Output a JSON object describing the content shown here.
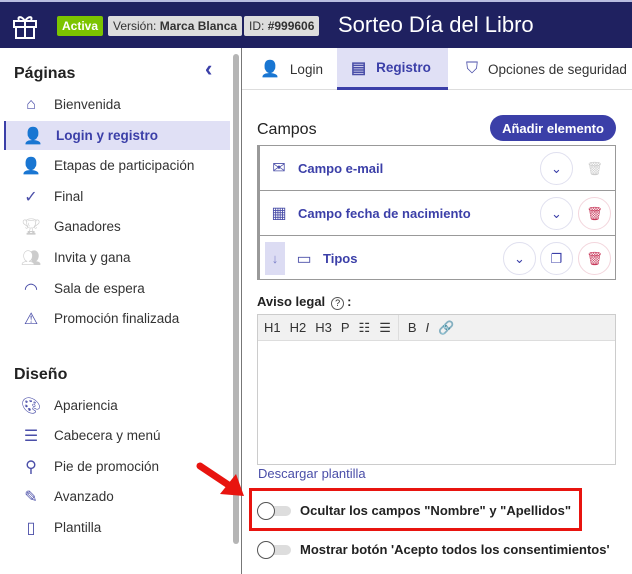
{
  "header": {
    "status": "Activa",
    "version_label": "Versión:",
    "version_value": "Marca Blanca",
    "id_label": "ID:",
    "id_value": "#999606",
    "title": "Sorteo Día del Libro"
  },
  "sidebar": {
    "pages_title": "Páginas",
    "pages": [
      {
        "label": "Bienvenida",
        "icon": "home-icon"
      },
      {
        "label": "Login y registro",
        "icon": "user-login-icon",
        "active": true
      },
      {
        "label": "Etapas de participación",
        "icon": "user-add-icon"
      },
      {
        "label": "Final",
        "icon": "check-icon"
      },
      {
        "label": "Ganadores",
        "icon": "trophy-icon"
      },
      {
        "label": "Invita y gana",
        "icon": "users-icon"
      },
      {
        "label": "Sala de espera",
        "icon": "gauge-icon"
      },
      {
        "label": "Promoción finalizada",
        "icon": "warning-icon"
      }
    ],
    "design_title": "Diseño",
    "design": [
      {
        "label": "Apariencia",
        "icon": "palette-icon"
      },
      {
        "label": "Cabecera y menú",
        "icon": "menu-icon"
      },
      {
        "label": "Pie de promoción",
        "icon": "footer-icon"
      },
      {
        "label": "Avanzado",
        "icon": "edit-icon"
      },
      {
        "label": "Plantilla",
        "icon": "file-icon"
      }
    ]
  },
  "tabs": [
    {
      "label": "Login"
    },
    {
      "label": "Registro",
      "active": true
    },
    {
      "label": "Opciones de seguridad"
    }
  ],
  "campos": {
    "title": "Campos",
    "add_label": "Añadir elemento",
    "fields": [
      {
        "label": "Campo e-mail"
      },
      {
        "label": "Campo fecha de nacimiento"
      },
      {
        "label": "Tipos"
      }
    ]
  },
  "legal": {
    "label": "Aviso legal",
    "suffix": ":",
    "toolbar": [
      "H1",
      "H2",
      "H3",
      "P",
      "☷",
      "☰",
      "B",
      "I",
      "🔗"
    ],
    "download": "Descargar plantilla"
  },
  "toggles": [
    {
      "label": "Ocultar los campos \"Nombre\" y \"Apellidos\"",
      "on": false
    },
    {
      "label": "Mostrar botón 'Acepto todos los consentimientos'",
      "on": false
    }
  ],
  "colors": {
    "header": "#1f2160",
    "accent": "#3b3fa8",
    "active": "#7cc400",
    "highlight": "#e8140f"
  }
}
